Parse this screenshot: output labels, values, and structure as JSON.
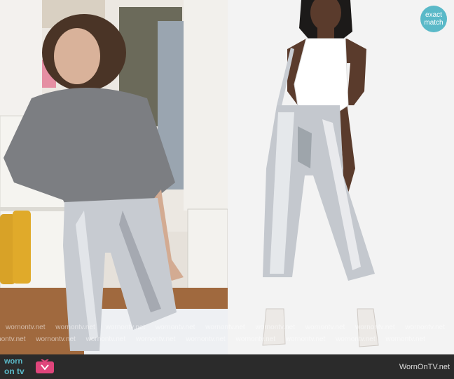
{
  "badge": {
    "line1": "exact",
    "line2": "match"
  },
  "watermark": {
    "text": "wornontv.net"
  },
  "footer": {
    "logo_top": "worn",
    "logo_bottom": "on tv",
    "site": "WornOnTV.net"
  },
  "colors": {
    "accent": "#5ab9c8",
    "footer_bg": "#2b2b2b"
  },
  "icons": {
    "logo": "tv-icon"
  }
}
